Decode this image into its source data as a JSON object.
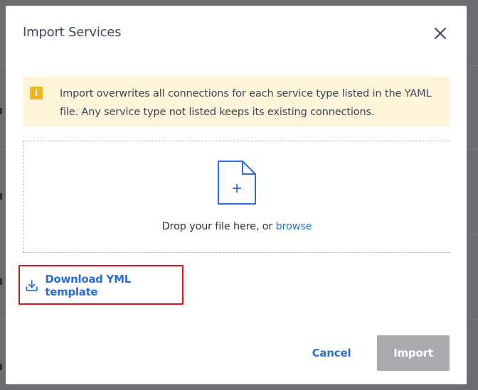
{
  "dialog": {
    "title": "Import Services",
    "close_icon": "close-icon"
  },
  "info_banner": {
    "icon": "info-icon",
    "icon_glyph": "i",
    "text": "Import overwrites all connections for each service type listed in the YAML file. Any service type not listed keeps its existing connections."
  },
  "dropzone": {
    "icon": "file-add-icon",
    "prompt": "Drop your file here, or",
    "browse_label": "browse"
  },
  "download": {
    "icon": "download-icon",
    "label": "Download YML template"
  },
  "footer": {
    "cancel_label": "Cancel",
    "import_label": "Import",
    "import_disabled": true
  },
  "colors": {
    "accent": "#2a6fd8",
    "banner_bg": "#fdf4d9",
    "banner_icon": "#f2b51d",
    "highlight_border": "#e2121b",
    "disabled_button": "#a9abaf"
  }
}
